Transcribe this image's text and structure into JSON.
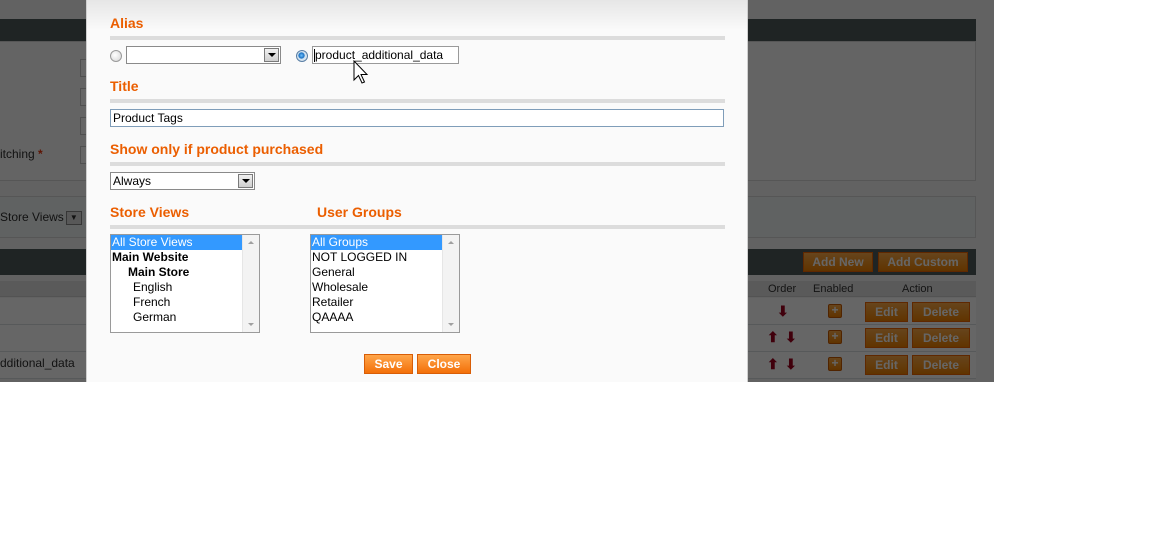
{
  "background": {
    "required_field_label": "itching",
    "required_marker": "*",
    "store_views_select": "Store Views",
    "add_new_label": "Add New",
    "add_custom_label": "Add Custom",
    "grid_columns": {
      "order": "Order",
      "enabled": "Enabled",
      "action": "Action"
    },
    "rows": [
      {
        "name": "",
        "order": [
          "down"
        ],
        "edit": "Edit",
        "delete": "Delete"
      },
      {
        "name": "",
        "order": [
          "up",
          "down"
        ],
        "edit": "Edit",
        "delete": "Delete"
      },
      {
        "name": "dditional_data",
        "order": [
          "up",
          "down"
        ],
        "edit": "Edit",
        "delete": "Delete"
      }
    ],
    "colors": {
      "header": "#4e5a5b",
      "button": "#f18200",
      "arrow": "#a0021f"
    }
  },
  "modal": {
    "alias": {
      "title": "Alias",
      "select_value": "",
      "text_value": "product_additional_data",
      "selected_mode": "text"
    },
    "title_section": {
      "title": "Title",
      "value": "Product Tags"
    },
    "purchased": {
      "title": "Show only if product purchased",
      "value": "Always"
    },
    "store_views": {
      "title": "Store Views",
      "options": [
        {
          "label": "All Store Views",
          "selected": true,
          "bold": false,
          "indent": 0
        },
        {
          "label": "Main Website",
          "selected": false,
          "bold": true,
          "indent": 0
        },
        {
          "label": "Main Store",
          "selected": false,
          "bold": true,
          "indent": 1
        },
        {
          "label": "English",
          "selected": false,
          "bold": false,
          "indent": 2
        },
        {
          "label": "French",
          "selected": false,
          "bold": false,
          "indent": 2
        },
        {
          "label": "German",
          "selected": false,
          "bold": false,
          "indent": 2
        }
      ]
    },
    "user_groups": {
      "title": "User Groups",
      "options": [
        {
          "label": "All Groups",
          "selected": true
        },
        {
          "label": "NOT LOGGED IN",
          "selected": false
        },
        {
          "label": "General",
          "selected": false
        },
        {
          "label": "Wholesale",
          "selected": false
        },
        {
          "label": "Retailer",
          "selected": false
        },
        {
          "label": "QAAAA",
          "selected": false
        }
      ]
    },
    "buttons": {
      "save": "Save",
      "close": "Close"
    },
    "colors": {
      "section_title": "#eb5e00",
      "button": "#f36f08",
      "selection": "#3399ff"
    }
  }
}
